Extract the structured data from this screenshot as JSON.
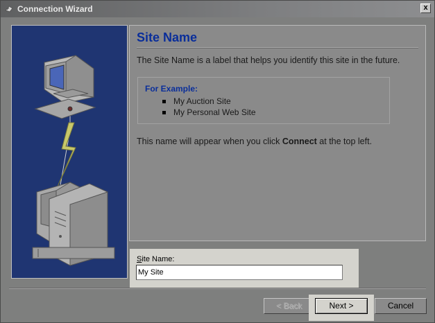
{
  "window": {
    "title": "Connection Wizard",
    "close_glyph": "x"
  },
  "page": {
    "title": "Site Name",
    "description": "The Site Name is a label that helps you identify this site in the future.",
    "example_title": "For Example:",
    "examples": [
      "My Auction Site",
      "My Personal Web Site"
    ],
    "note_before": "This name will appear when you click ",
    "note_bold": "Connect",
    "note_after": " at the top left."
  },
  "field": {
    "label_underlined": "S",
    "label_rest": "ite Name:",
    "value": "My Site"
  },
  "buttons": {
    "back": "< Back",
    "next": "Next >",
    "cancel": "Cancel"
  },
  "colors": {
    "accent": "#0a2e9a",
    "side_panel": "#1f3572",
    "highlight": "#d4d3cd"
  },
  "icons": {
    "title": "connection-wizard-icon",
    "side_illustration": "computer-connection-illustration"
  }
}
